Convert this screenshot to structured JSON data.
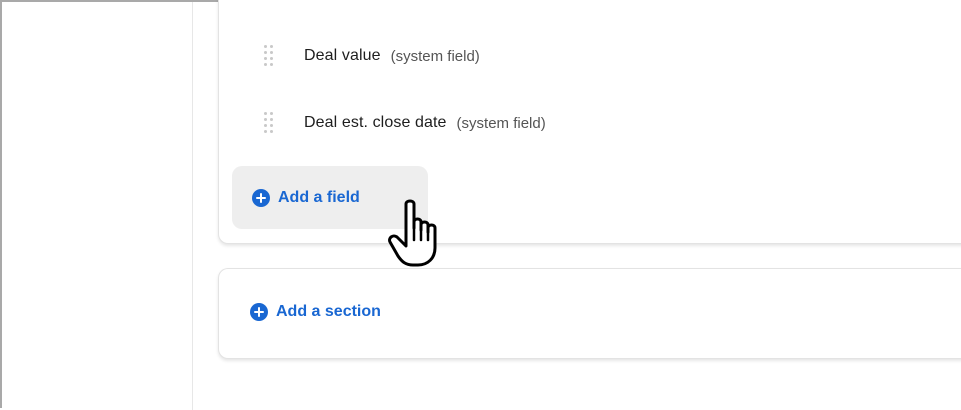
{
  "fields": [
    {
      "name": "Deal value",
      "note": "(system field)"
    },
    {
      "name": "Deal est. close date",
      "note": "(system field)"
    }
  ],
  "actions": {
    "add_field_label": "Add a field",
    "add_section_label": "Add a section"
  },
  "colors": {
    "accent": "#1967d2",
    "button_hover_bg": "#eeeeee",
    "text_primary": "#1e1e1e",
    "text_secondary": "#555555"
  },
  "icons": {
    "drag": "drag-handle-icon",
    "add": "plus-circle-icon",
    "pointer": "hand-pointer-icon"
  }
}
